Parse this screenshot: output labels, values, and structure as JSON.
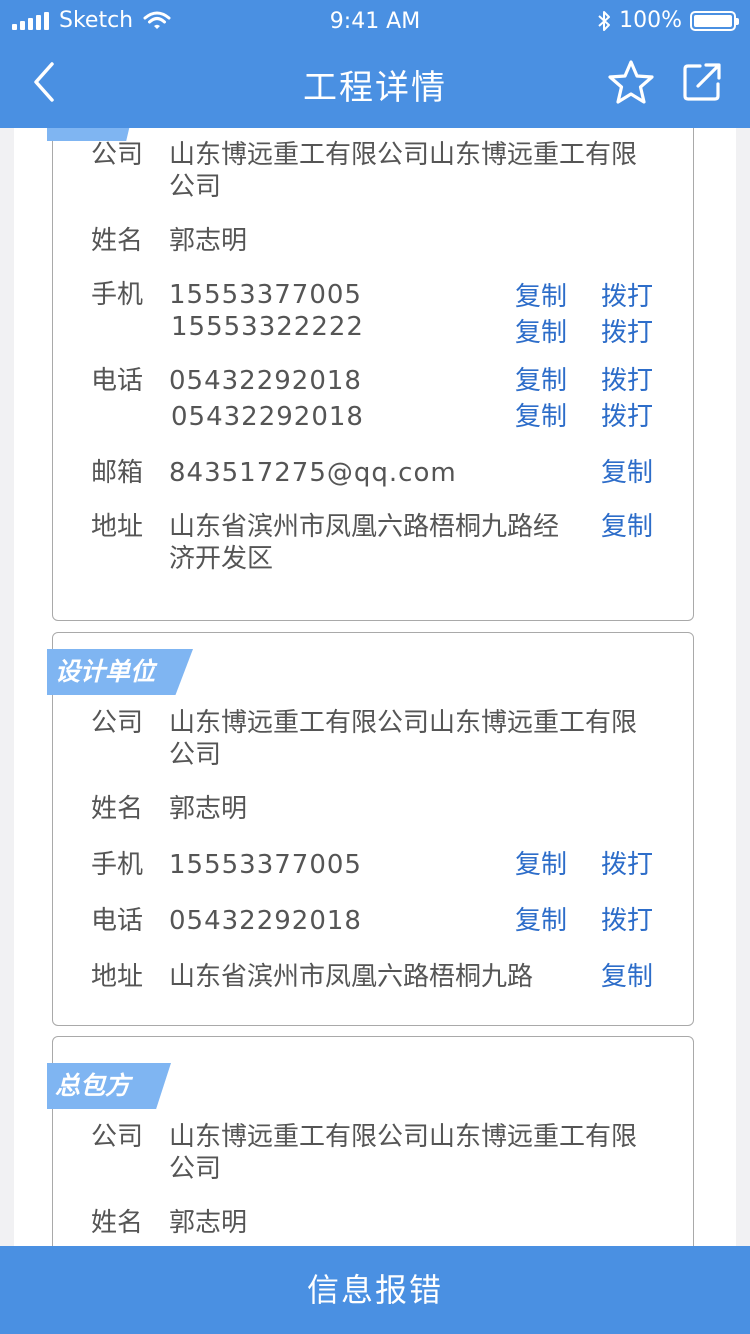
{
  "status_bar": {
    "carrier": "Sketch",
    "time": "9:41 AM",
    "battery": "100%"
  },
  "nav": {
    "title": "工程详情"
  },
  "labels": {
    "company": "公司",
    "name": "姓名",
    "mobile": "手机",
    "phone": "电话",
    "email": "邮箱",
    "address": "地址",
    "copy": "复制",
    "dial": "拨打"
  },
  "cards": [
    {
      "company": "山东博远重工有限公司山东博远重工有限公司",
      "name": "郭志明",
      "mobiles": [
        "15553377005",
        "15553322222"
      ],
      "phones": [
        "05432292018",
        "05432292018"
      ],
      "email": "843517275@qq.com",
      "address": "山东省滨州市凤凰六路梧桐九路经济开发区"
    },
    {
      "tag": "设计单位",
      "company": "山东博远重工有限公司山东博远重工有限公司",
      "name": "郭志明",
      "mobiles": [
        "15553377005"
      ],
      "phones": [
        "05432292018"
      ],
      "address": "山东省滨州市凤凰六路梧桐九路"
    },
    {
      "tag": "总包方",
      "company": "山东博远重工有限公司山东博远重工有限公司",
      "name": "郭志明"
    }
  ],
  "footer": {
    "button": "信息报错"
  },
  "colors": {
    "primary": "#4a90e2",
    "tag": "#7fb5f2",
    "link": "#2d6dc9"
  }
}
